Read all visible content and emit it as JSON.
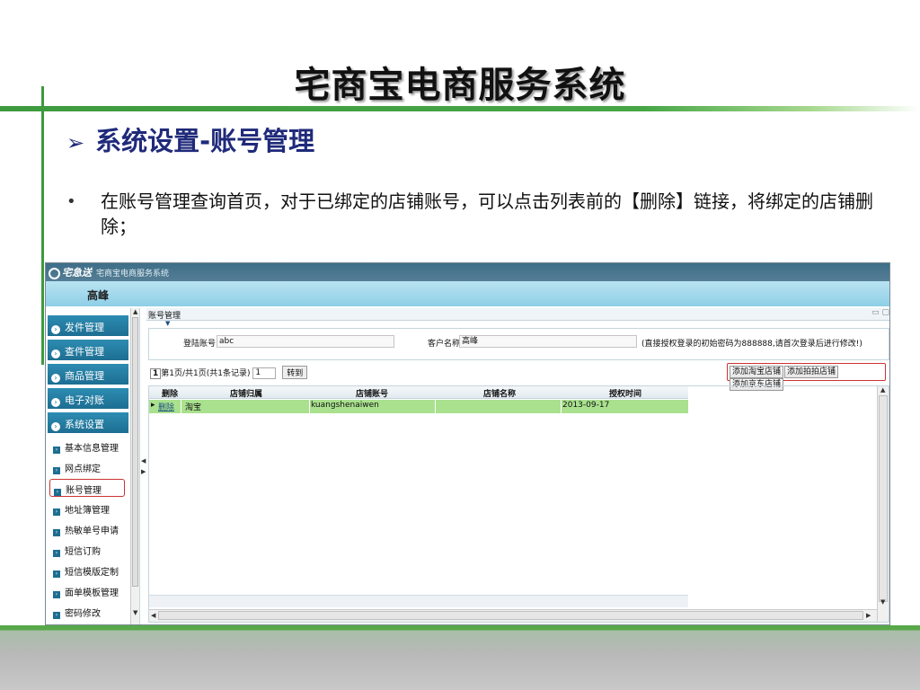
{
  "slide": {
    "title": "宅商宝电商服务系统",
    "heading": "系统设置-账号管理",
    "heading_marker": "➢",
    "bullet": "•",
    "bullet_text": "在账号管理查询首页，对于已绑定的店铺账号，可以点击列表前的【删除】链接，将绑定的店铺删除；"
  },
  "app": {
    "logo_text": "宅急送",
    "system_name": "宅商宝电商服务系统",
    "user_name": "高峰",
    "sidebar": {
      "main_items": [
        {
          "label": "发件管理"
        },
        {
          "label": "查件管理"
        },
        {
          "label": "商品管理"
        },
        {
          "label": "电子对账"
        },
        {
          "label": "系统设置"
        }
      ],
      "sub_items": [
        {
          "label": "基本信息管理"
        },
        {
          "label": "网点绑定"
        },
        {
          "label": "账号管理"
        },
        {
          "label": "地址簿管理"
        },
        {
          "label": "热敏单号申请"
        },
        {
          "label": "短信订购"
        },
        {
          "label": "短信模版定制"
        },
        {
          "label": "面单模板管理"
        },
        {
          "label": "密码修改"
        }
      ],
      "active_sub": "账号管理"
    },
    "content": {
      "title": "账号管理",
      "window_buttons": "▭ ▢",
      "form": {
        "login_label": "登陆账号",
        "login_value": "abc",
        "customer_label": "客户名称",
        "customer_value": "高峰",
        "note": "(直接授权登录的初始密码为888888,请首次登录后进行修改!)"
      },
      "pager": {
        "page_num": "1",
        "page_info": "第1页/共1页(共1条记录)",
        "page_input": "1",
        "go_label": "转到"
      },
      "add_buttons": [
        "添加淘宝店铺",
        "添加拍拍店铺",
        "添加京东店铺"
      ],
      "table": {
        "columns": [
          "删除",
          "店铺归属",
          "店铺账号",
          "店铺名称",
          "授权时间"
        ],
        "rows": [
          {
            "marker": "▸",
            "delete": "删除",
            "belong": "淘宝",
            "account": "kuangshenaiwen",
            "name": "",
            "time": "2013-09-17"
          }
        ]
      }
    }
  }
}
